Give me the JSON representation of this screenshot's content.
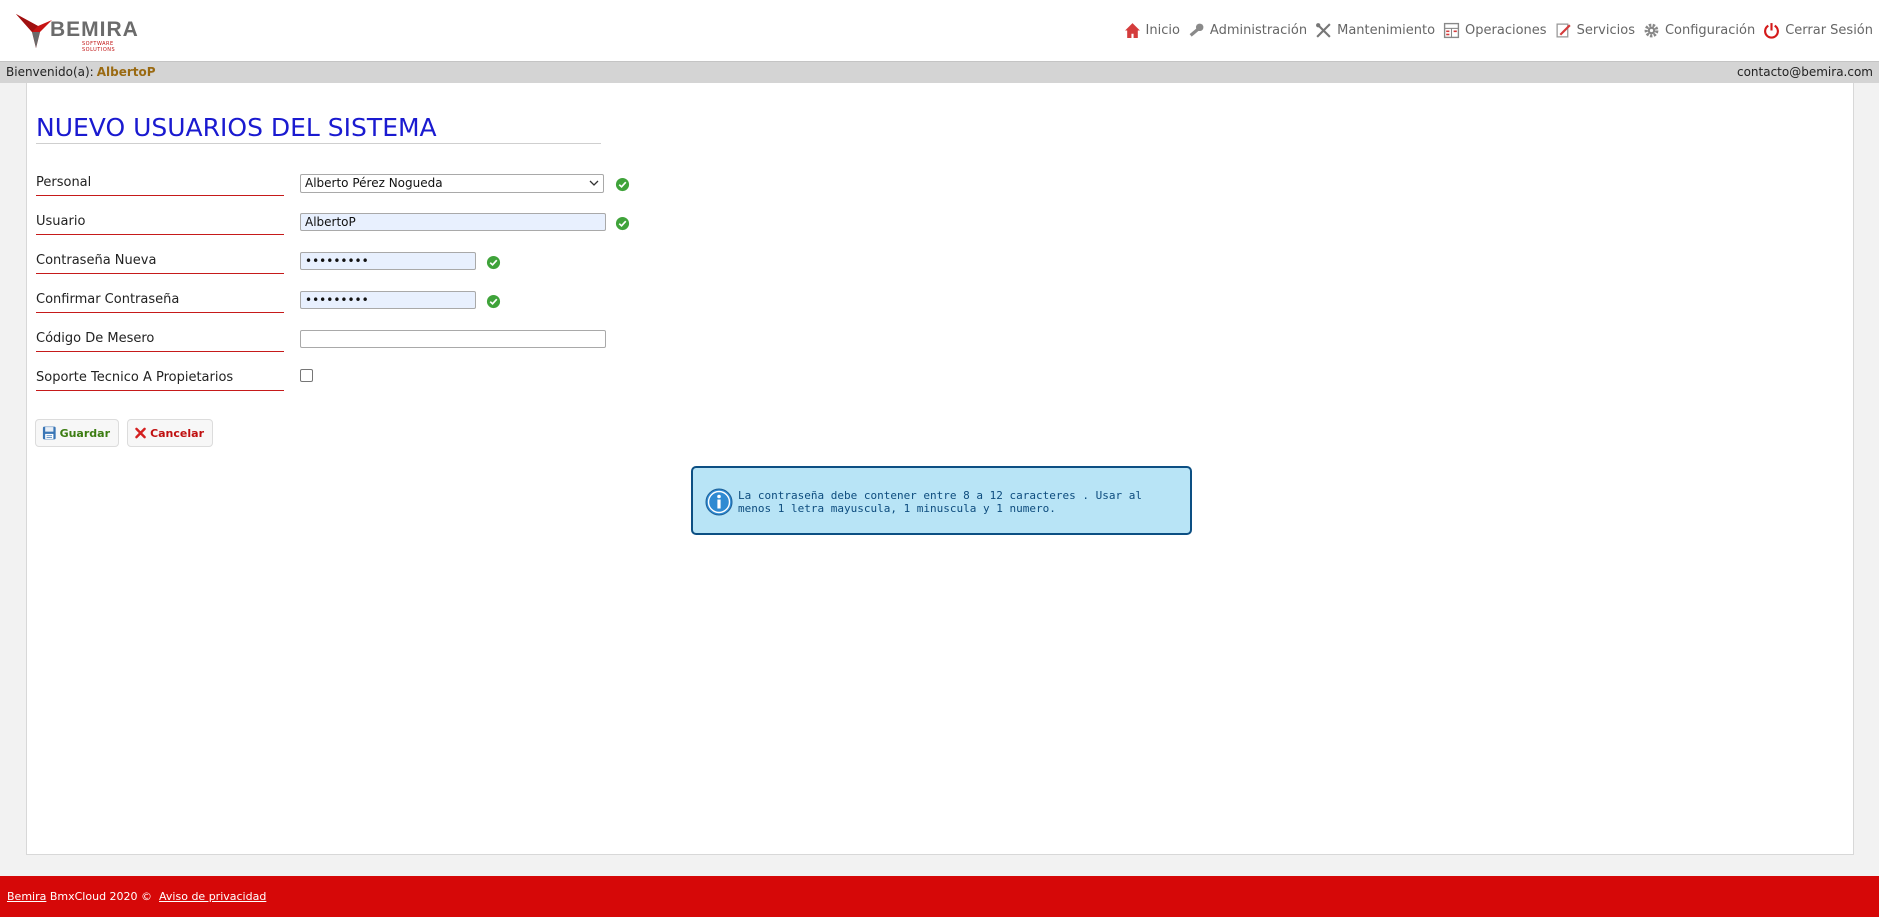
{
  "header": {
    "logo_text": "BEMIRA",
    "logo_subtext": "SOFTWARE SOLUTIONS",
    "nav": [
      {
        "label": "Inicio",
        "icon": "home-icon"
      },
      {
        "label": "Administración",
        "icon": "key-icon"
      },
      {
        "label": "Mantenimiento",
        "icon": "tools-icon"
      },
      {
        "label": "Operaciones",
        "icon": "calculator-icon"
      },
      {
        "label": "Servicios",
        "icon": "edit-icon"
      },
      {
        "label": "Configuración",
        "icon": "gear-icon"
      },
      {
        "label": "Cerrar Sesión",
        "icon": "power-icon"
      }
    ]
  },
  "welcome": {
    "prefix": "Bienvenido(a):",
    "user": "AlbertoP",
    "email": "contacto@bemira.com"
  },
  "page": {
    "title": "NUEVO USUARIOS DEL SISTEMA"
  },
  "form": {
    "personal": {
      "label": "Personal",
      "value": "Alberto Pérez Nogueda"
    },
    "usuario": {
      "label": "Usuario",
      "value": "AlbertoP"
    },
    "contrasena_nueva": {
      "label": "Contraseña Nueva",
      "value": "•••••••••"
    },
    "confirmar": {
      "label": "Confirmar Contraseña",
      "value": "•••••••••"
    },
    "codigo_mesero": {
      "label": "Código De Mesero",
      "value": ""
    },
    "soporte": {
      "label": "Soporte Tecnico A Propietarios",
      "checked": false
    }
  },
  "buttons": {
    "save_label": "Guardar",
    "cancel_label": "Cancelar"
  },
  "info": {
    "text": "La contraseña debe contener entre 8 a 12 caracteres . Usar al menos 1 letra mayuscula, 1 minuscula y 1 numero."
  },
  "footer": {
    "brand_link": "Bemira",
    "copyright": " BmxCloud 2020 © ",
    "privacy_link": "Aviso de privacidad"
  },
  "colors": {
    "accent_red": "#d60808",
    "title_blue": "#1a1ad0",
    "info_bg": "#b8e4f6",
    "info_border": "#0c4f83",
    "ok_green": "#3fa33a"
  }
}
